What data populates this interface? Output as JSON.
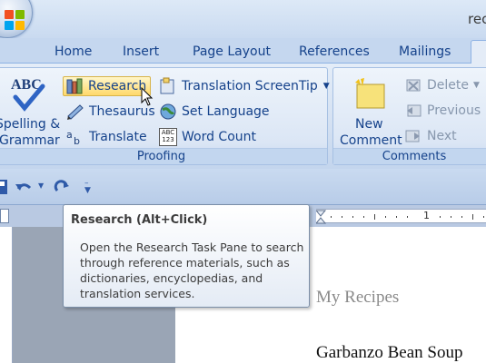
{
  "title_bar": {
    "doc_title": "rec"
  },
  "tabs": [
    {
      "label": "Home"
    },
    {
      "label": "Insert"
    },
    {
      "label": "Page Layout"
    },
    {
      "label": "References"
    },
    {
      "label": "Mailings"
    }
  ],
  "ribbon": {
    "proofing": {
      "group_label": "Proofing",
      "spelling": {
        "icon_text": "ABC",
        "label_line1": "Spelling &",
        "label_line2": "Grammar"
      },
      "research": "Research",
      "thesaurus": "Thesaurus",
      "translate": "Translate",
      "translation_screentip": "Translation ScreenTip",
      "set_language": "Set Language",
      "word_count": "Word Count",
      "word_count_icon_text": "ABC\n123"
    },
    "comments": {
      "group_label": "Comments",
      "new_comment_line1": "New",
      "new_comment_line2": "Comment",
      "delete": "Delete",
      "previous": "Previous",
      "next": "Next"
    }
  },
  "ruler": {
    "marker": "1"
  },
  "tooltip": {
    "title": "Research (Alt+Click)",
    "body": "Open the Research Task Pane to search through reference materials, such as dictionaries, encyclopedias, and translation services."
  },
  "document": {
    "heading": "My Recipes",
    "subheading": "Garbanzo Bean Soup"
  },
  "colors": {
    "ribbon_text": "#15428b",
    "research_highlight": "#ffd96b",
    "disabled_text": "#8797ad"
  },
  "icons": {
    "office": "office-logo-icon",
    "spelling": "spelling-check-icon",
    "research": "research-books-icon",
    "thesaurus": "thesaurus-icon",
    "translate": "translate-icon",
    "screentip": "translation-screentip-icon",
    "set_language": "set-language-icon",
    "word_count": "word-count-icon",
    "new_comment": "new-comment-icon",
    "delete": "delete-comment-icon",
    "previous": "previous-comment-icon",
    "next": "next-comment-icon",
    "save": "save-icon",
    "undo": "undo-icon",
    "redo": "redo-icon",
    "customize": "customize-qat-icon"
  }
}
